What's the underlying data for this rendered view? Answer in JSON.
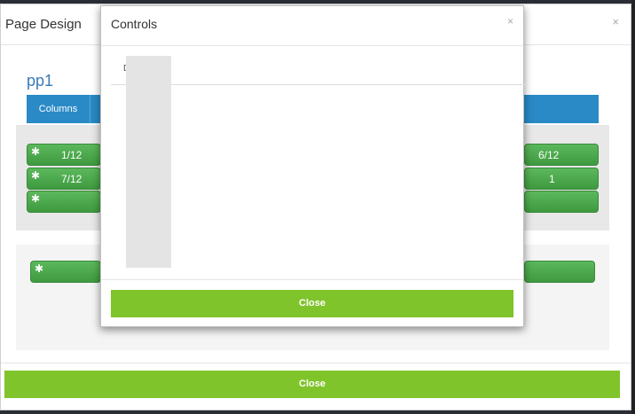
{
  "page_design": {
    "title": "Page Design",
    "close_x": "×",
    "page_name": "pp1",
    "tabs": [
      {
        "label": "Columns"
      }
    ],
    "panel1_rows": [
      {
        "left_label": "1/12",
        "right_label": "6/12"
      },
      {
        "left_label": "7/12",
        "right_label": "1"
      },
      {
        "left_label": "",
        "right_label": ""
      }
    ],
    "panel2_rows": [
      {
        "label": ""
      }
    ],
    "cog_icon": "✱",
    "close_label": "Close"
  },
  "controls": {
    "title": "Controls",
    "close_x": "×",
    "tab_label": "D",
    "close_label": "Close"
  },
  "colors": {
    "primary_blue": "#2a8ac6",
    "green_bar": "#5cb85c",
    "close_green": "#80c42b"
  }
}
